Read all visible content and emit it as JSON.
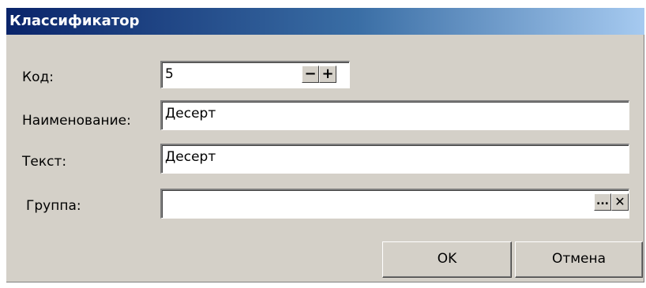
{
  "window": {
    "title": "Классификатор"
  },
  "form": {
    "code": {
      "label": "Код:",
      "value": "5",
      "minus": "−",
      "plus": "+"
    },
    "name": {
      "label": "Наименование:",
      "value": "Десерт"
    },
    "text": {
      "label": "Текст:",
      "value": "Десерт"
    },
    "group": {
      "label": "Группа:",
      "value": "",
      "browse": "...",
      "clear": "✕"
    }
  },
  "buttons": {
    "ok": "OK",
    "cancel": "Отмена"
  }
}
